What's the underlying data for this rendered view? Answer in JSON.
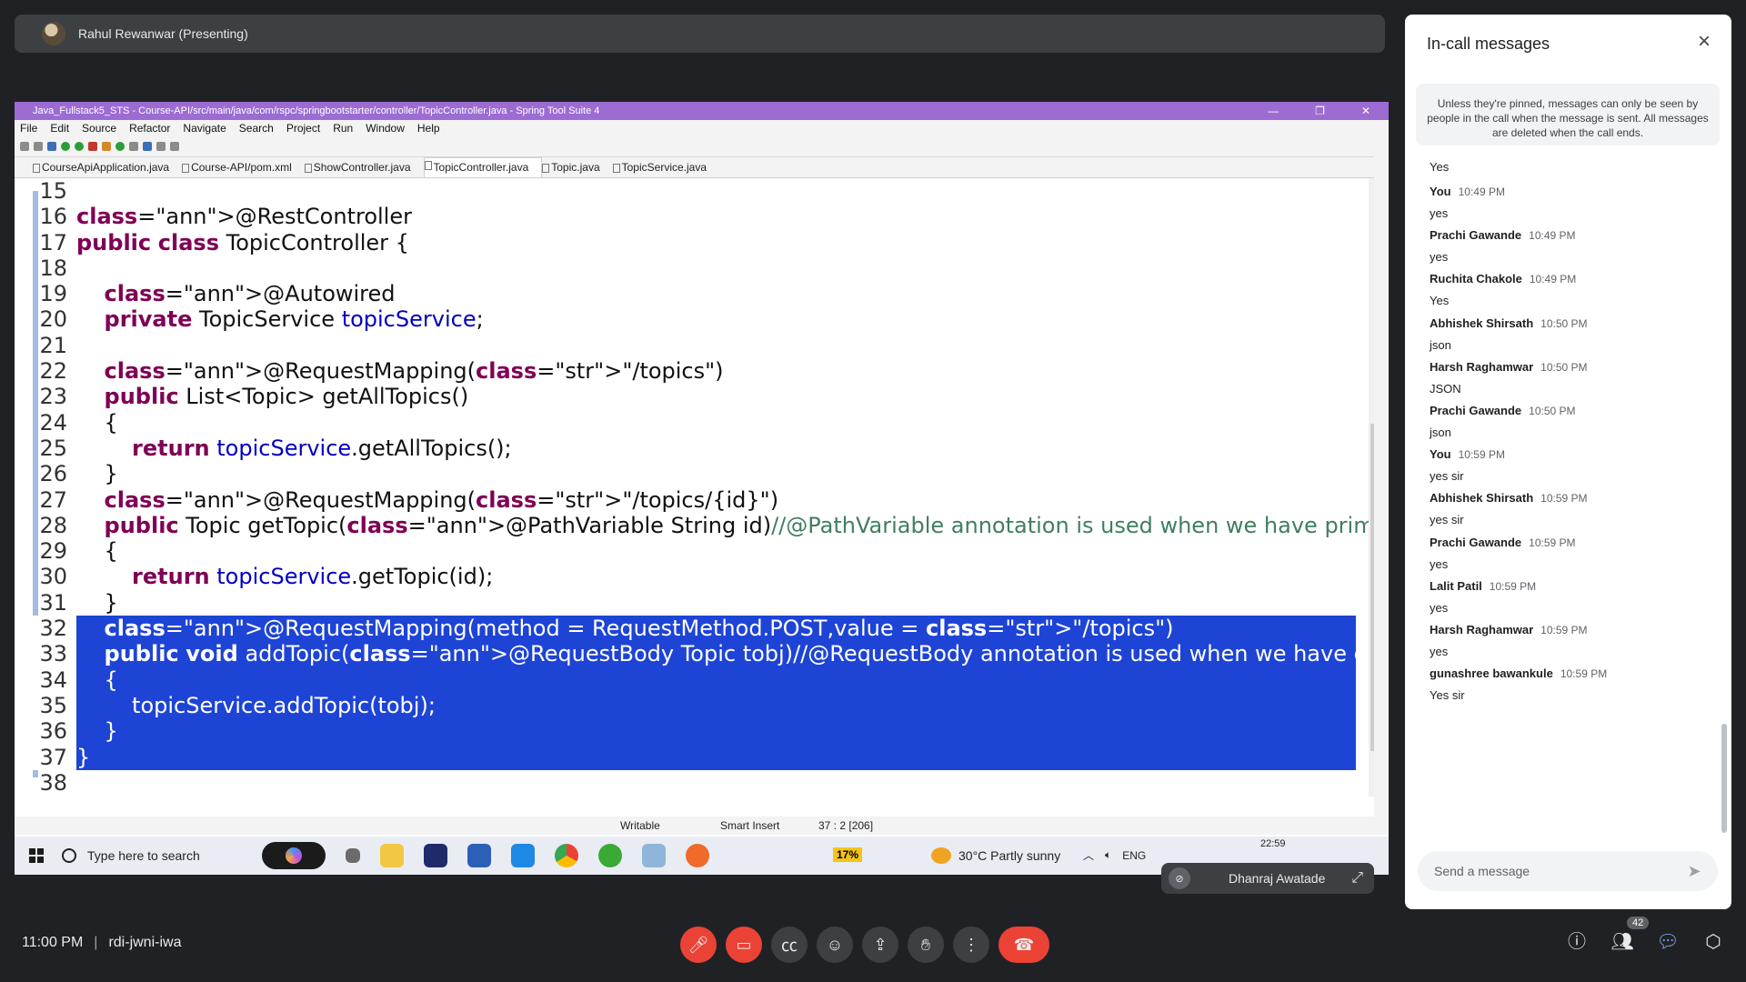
{
  "presenter": {
    "label": "Rahul Rewanwar (Presenting)"
  },
  "ide": {
    "title": "Java_Fullstack5_STS - Course-API/src/main/java/com/rspc/springbootstarter/controller/TopicController.java - Spring Tool Suite 4",
    "menu": [
      "File",
      "Edit",
      "Source",
      "Refactor",
      "Navigate",
      "Search",
      "Project",
      "Run",
      "Window",
      "Help"
    ],
    "tabs": [
      "CourseApiApplication.java",
      "Course-API/pom.xml",
      "ShowController.java",
      "TopicController.java",
      "Topic.java",
      "TopicService.java"
    ],
    "active_tab": "TopicController.java",
    "code": [
      {
        "n": "15",
        "t": ""
      },
      {
        "n": "16",
        "t": "@RestController"
      },
      {
        "n": "17",
        "t": "public class TopicController {"
      },
      {
        "n": "18",
        "t": ""
      },
      {
        "n": "19",
        "t": "    @Autowired"
      },
      {
        "n": "20",
        "t": "    private TopicService topicService;"
      },
      {
        "n": "21",
        "t": ""
      },
      {
        "n": "22",
        "t": "    @RequestMapping(\"/topics\")"
      },
      {
        "n": "23",
        "t": "    public List<Topic> getAllTopics()"
      },
      {
        "n": "24",
        "t": "    {"
      },
      {
        "n": "25",
        "t": "        return topicService.getAllTopics();"
      },
      {
        "n": "26",
        "t": "    }"
      },
      {
        "n": "27",
        "t": "    @RequestMapping(\"/topics/{id}\")"
      },
      {
        "n": "28",
        "t": "    public Topic getTopic(@PathVariable String id)//@PathVariable annotation is used when we have primitive data"
      },
      {
        "n": "29",
        "t": "    {"
      },
      {
        "n": "30",
        "t": "        return topicService.getTopic(id);"
      },
      {
        "n": "31",
        "t": "    }"
      },
      {
        "n": "32",
        "t": "    @RequestMapping(method = RequestMethod.POST,value = \"/topics\")"
      },
      {
        "n": "33",
        "t": "    public void addTopic(@RequestBody Topic tobj)//@RequestBody annotation is used when we have class"
      },
      {
        "n": "34",
        "t": "    {"
      },
      {
        "n": "35",
        "t": "        topicService.addTopic(tobj);"
      },
      {
        "n": "36",
        "t": "    }"
      },
      {
        "n": "37",
        "t": "}"
      },
      {
        "n": "38",
        "t": ""
      }
    ],
    "status": {
      "writable": "Writable",
      "insert": "Smart Insert",
      "position": "37 : 2 [206]"
    }
  },
  "taskbar": {
    "search_placeholder": "Type here to search",
    "battery": "17%",
    "weather": "30°C  Partly sunny",
    "lang": "ENG",
    "time": "22:59"
  },
  "self_tile": {
    "name": "Dhanraj Awatade"
  },
  "panel": {
    "title": "In-call messages",
    "notice": "Unless they're pinned, messages can only be seen by people in the call when the message is sent. All messages are deleted when the call ends.",
    "first_text": "Yes",
    "messages": [
      {
        "sender": "You",
        "time": "10:49 PM",
        "text": "yes"
      },
      {
        "sender": "Prachi Gawande",
        "time": "10:49 PM",
        "text": "yes"
      },
      {
        "sender": "Ruchita Chakole",
        "time": "10:49 PM",
        "text": "Yes"
      },
      {
        "sender": "Abhishek Shirsath",
        "time": "10:50 PM",
        "text": "json"
      },
      {
        "sender": "Harsh Raghamwar",
        "time": "10:50 PM",
        "text": "JSON"
      },
      {
        "sender": "Prachi Gawande",
        "time": "10:50 PM",
        "text": "json"
      },
      {
        "sender": "You",
        "time": "10:59 PM",
        "text": "yes sir"
      },
      {
        "sender": "Abhishek Shirsath",
        "time": "10:59 PM",
        "text": "yes sir"
      },
      {
        "sender": "Prachi Gawande",
        "time": "10:59 PM",
        "text": "yes"
      },
      {
        "sender": "Lalit Patil",
        "time": "10:59 PM",
        "text": "yes"
      },
      {
        "sender": "Harsh Raghamwar",
        "time": "10:59 PM",
        "text": "yes"
      },
      {
        "sender": "gunashree bawankule",
        "time": "10:59 PM",
        "text": "Yes sir"
      }
    ],
    "composer_placeholder": "Send a message"
  },
  "meeting": {
    "time": "11:00 PM",
    "code": "rdi-jwni-iwa",
    "participants": "42"
  },
  "icons": {
    "mic": "mic-off-icon",
    "cam": "camera-off-icon",
    "cc": "captions-icon",
    "emoji": "emoji-icon",
    "present": "present-icon",
    "hand": "raise-hand-icon",
    "more": "more-vert-icon",
    "end": "end-call-icon",
    "info": "info-icon",
    "people": "people-icon",
    "chat": "chat-icon",
    "activities": "activities-icon"
  },
  "colors": {
    "selection": "#1e44d6",
    "end_call": "#ea4335",
    "ide_title": "#9c6cd3"
  }
}
